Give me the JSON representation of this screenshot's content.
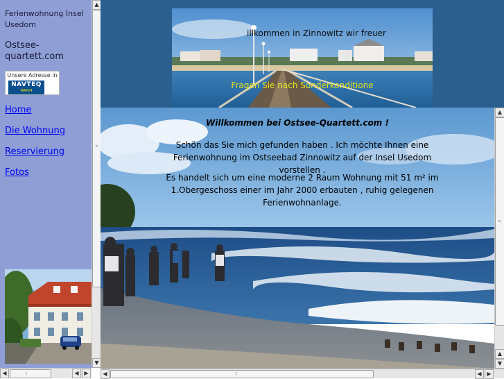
{
  "left": {
    "site_title": "Ferienwohnung Insel Usedom",
    "site_domain": "Ostsee-quartett.com",
    "map_badge": {
      "caption": "Unsere Adresse in",
      "logo": "NAVTEQ",
      "logo_sub": "MAP24"
    },
    "nav": [
      {
        "label": "Home"
      },
      {
        "label": "Die Wohnung"
      },
      {
        "label": "Reservierung"
      },
      {
        "label": "Fotos"
      }
    ]
  },
  "banner": {
    "marquee_text": "illkommen in Zinnowitz wir freuer",
    "offer_text": "Fragen Sie nach Sonderkonditione"
  },
  "main": {
    "heading": "Willkommen bei Ostsee-Quartett.com !",
    "paragraph_1": "Schön das Sie mich gefunden haben . Ich möchte Ihnen eine Ferienwohnung im Ostseebad Zinnowitz auf der Insel Usedom vorstellen .",
    "paragraph_2": "Es handelt sich um eine moderne 2 Raum Wohnung mit 51 m² im 1.Obergeschoss einer im Jahr 2000 erbauten , ruhig gelegenen Ferienwohnanlage."
  },
  "scrollbars": {
    "up_glyph": "▲",
    "down_glyph": "▼",
    "left_glyph": "◀",
    "right_glyph": "▶"
  },
  "colors": {
    "left_background": "#8f9fd6",
    "top_background": "#2a5f8e",
    "link": "#0000ee",
    "offer_text": "#e4e41c"
  }
}
